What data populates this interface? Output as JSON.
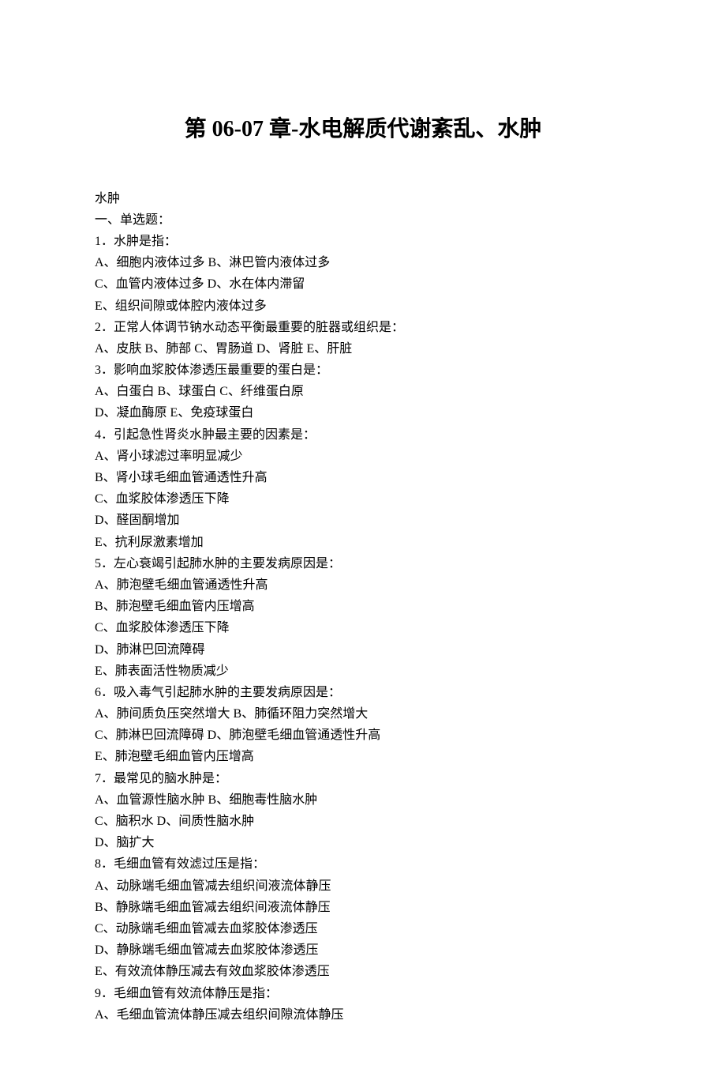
{
  "title": "第 06-07 章-水电解质代谢紊乱、水肿",
  "lines": [
    "水肿",
    "一、单选题：",
    "1．水肿是指：",
    "A、细胞内液体过多   B、淋巴管内液体过多",
    "C、血管内液体过多    D、水在体内滞留",
    "E、组织间隙或体腔内液体过多",
    "2．正常人体调节钠水动态平衡最重要的脏器或组织是：",
    "A、皮肤    B、肺部    C、胃肠道    D、肾脏    E、肝脏",
    "3．影响血浆胶体渗透压最重要的蛋白是：",
    "A、白蛋白    B、球蛋白       C、纤维蛋白原",
    "D、凝血酶原     E、免疫球蛋白",
    "4．引起急性肾炎水肿最主要的因素是：",
    "A、肾小球滤过率明显减少",
    "B、肾小球毛细血管通透性升高",
    "C、血浆胶体渗透压下降",
    "D、醛固酮增加",
    "E、抗利尿激素增加",
    "5．左心衰竭引起肺水肿的主要发病原因是：",
    "A、肺泡壁毛细血管通透性升高",
    "B、肺泡壁毛细血管内压增高",
    "C、血浆胶体渗透压下降",
    "D、肺淋巴回流障碍",
    "E、肺表面活性物质减少",
    "6．吸入毒气引起肺水肿的主要发病原因是：",
    "A、肺间质负压突然增大        B、肺循环阻力突然增大",
    "C、肺淋巴回流障碍                   D、肺泡壁毛细血管通透性升高",
    "E、肺泡壁毛细血管内压增高",
    "7．最常见的脑水肿是：",
    "A、血管源性脑水肿      B、细胞毒性脑水肿",
    "C、脑积水                             D、间质性脑水肿",
    "D、脑扩大",
    "8．毛细血管有效滤过压是指：",
    "A、动脉端毛细血管减去组织间液流体静压",
    "B、静脉端毛细血管减去组织间液流体静压",
    "C、动脉端毛细血管减去血浆胶体渗透压",
    "D、静脉端毛细血管减去血浆胶体渗透压",
    "E、有效流体静压减去有效血浆胶体渗透压",
    "9．毛细血管有效流体静压是指：",
    "A、毛细血管流体静压减去组织间隙流体静压"
  ]
}
